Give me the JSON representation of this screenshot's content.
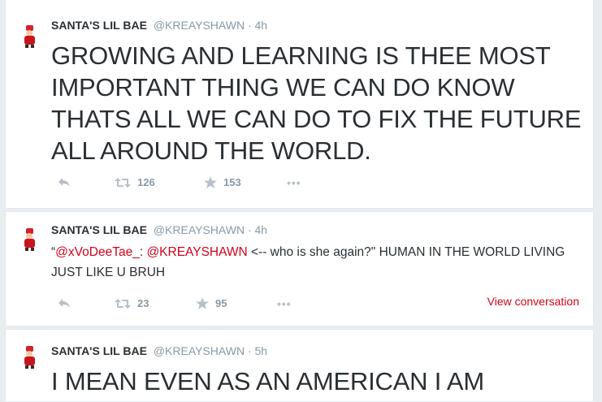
{
  "tweets": [
    {
      "display_name": "SANTA'S LIL BAE",
      "handle": "@KREAYSHAWN",
      "separator": "·",
      "time": "4h",
      "text": "GROWING AND LEARNING IS THEE MOST IMPORTANT THING WE CAN DO KNOW THATS ALL WE CAN DO TO FIX THE FUTURE ALL AROUND THE WORLD.",
      "retweets": "126",
      "favorites": "153"
    },
    {
      "display_name": "SANTA'S LIL BAE",
      "handle": "@KREAYSHAWN",
      "separator": "·",
      "time": "4h",
      "text_parts": {
        "open_quote": "“",
        "mention1": "@xVoDeeTae_",
        "colon": ": ",
        "mention2": "@KREAYSHAWN",
        "rest": " <-- who is she again?\" HUMAN IN THE WORLD LIVING JUST LIKE U BRUH"
      },
      "retweets": "23",
      "favorites": "95",
      "view_conversation": "View conversation"
    },
    {
      "display_name": "SANTA'S LIL BAE",
      "handle": "@KREAYSHAWN",
      "separator": "·",
      "time": "5h",
      "text": "I MEAN EVEN AS AN AMERICAN I AM"
    }
  ],
  "icons": {
    "reply": "reply-icon",
    "retweet": "retweet-icon",
    "favorite": "star-icon",
    "more": "more-icon",
    "more_glyph": "•••"
  },
  "colors": {
    "mention": "#d0021b",
    "muted": "#8899a6",
    "text": "#292f33"
  }
}
